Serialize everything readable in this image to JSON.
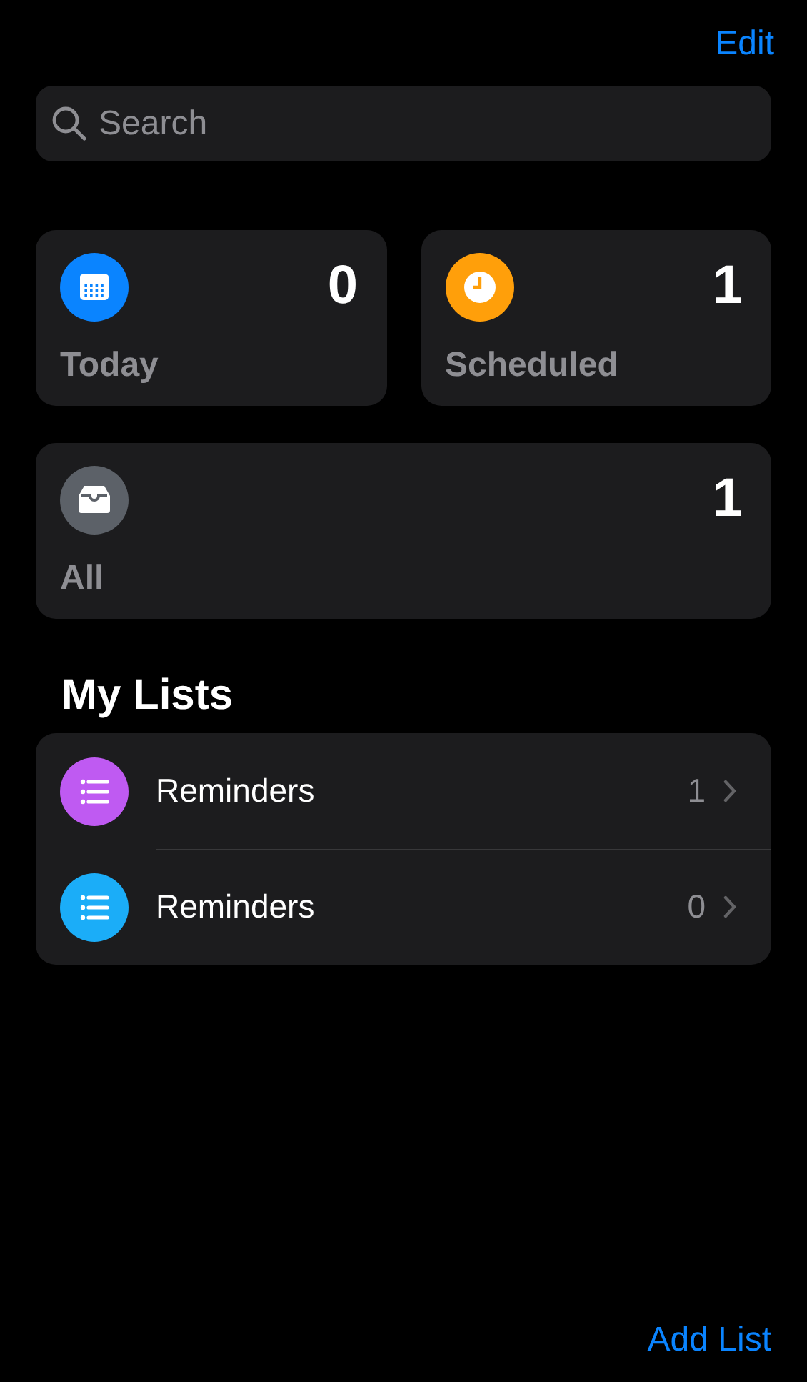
{
  "toolbar": {
    "edit": "Edit"
  },
  "search": {
    "placeholder": "Search"
  },
  "smart_lists": [
    {
      "kind": "today",
      "label": "Today",
      "count": "0",
      "color": "#0a84ff"
    },
    {
      "kind": "scheduled",
      "label": "Scheduled",
      "count": "1",
      "color": "#ff9f0a"
    },
    {
      "kind": "all",
      "label": "All",
      "count": "1",
      "color": "#5c6168"
    }
  ],
  "my_lists": {
    "title": "My Lists",
    "items": [
      {
        "name": "Reminders",
        "count": "1",
        "color": "#bf5af2"
      },
      {
        "name": "Reminders",
        "count": "0",
        "color": "#1badf8"
      }
    ]
  },
  "footer": {
    "add_list": "Add List"
  }
}
